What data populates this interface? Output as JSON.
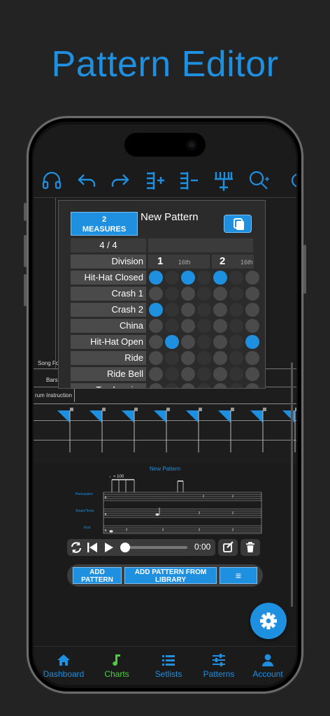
{
  "headline": "Pattern Editor",
  "toolbar": {
    "icons": [
      "headphones-icon",
      "undo-icon",
      "redo-icon",
      "add-measure-icon",
      "remove-measure-icon",
      "add-instrument-icon",
      "zoom-in-icon"
    ]
  },
  "pattern": {
    "measures_label": "2\nMEASURES",
    "name": "New Pattern",
    "time_signature": "4 / 4",
    "division_label": "Division",
    "beats": [
      {
        "number": "1",
        "sub": "16th"
      },
      {
        "number": "2",
        "sub": "16th"
      }
    ],
    "instruments": [
      {
        "name": "Hit-Hat Closed",
        "on": [
          0,
          2,
          4
        ]
      },
      {
        "name": "Crash 1",
        "on": []
      },
      {
        "name": "Crash 2",
        "on": [
          0
        ]
      },
      {
        "name": "China",
        "on": []
      },
      {
        "name": "Hit-Hat Open",
        "on": [
          1,
          6
        ]
      },
      {
        "name": "Ride",
        "on": []
      },
      {
        "name": "Ride Bell",
        "on": []
      },
      {
        "name": "Tambourine",
        "on": []
      }
    ]
  },
  "staff": {
    "song_form_label": "Song Fo",
    "bars_label": "Bars",
    "drum_instruction_label": "rum Instruction"
  },
  "notation": {
    "title": "New Pattern",
    "tempo": "♩= 100",
    "rows": [
      "Percussion",
      "Snare/Toms",
      "Kick"
    ]
  },
  "transport": {
    "time": "0:00",
    "progress": 0.0
  },
  "actions": {
    "add_pattern": "ADD PATTERN",
    "add_from_library": "ADD PATTERN FROM LIBRARY",
    "menu": "≡"
  },
  "tabs": [
    {
      "label": "Dashboard",
      "icon": "home-icon",
      "active": false
    },
    {
      "label": "Charts",
      "icon": "music-note-icon",
      "active": true
    },
    {
      "label": "Setlists",
      "icon": "list-icon",
      "active": false
    },
    {
      "label": "Patterns",
      "icon": "sliders-icon",
      "active": false
    },
    {
      "label": "Account",
      "icon": "person-icon",
      "active": false
    }
  ],
  "colors": {
    "accent": "#1f8fe0",
    "active_tab": "#4ccf3c",
    "background": "#232323"
  }
}
